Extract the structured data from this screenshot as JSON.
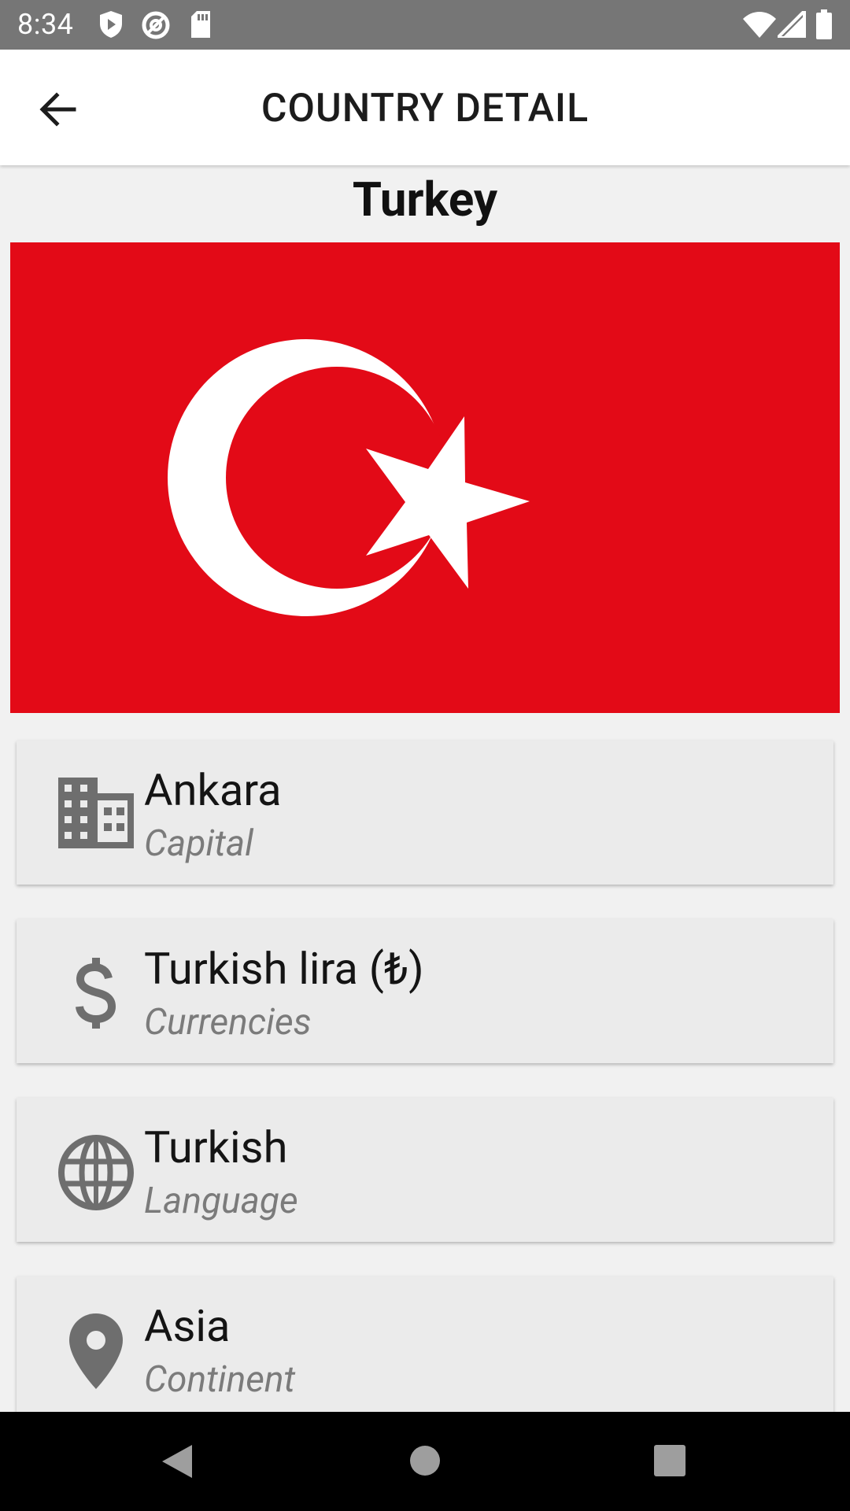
{
  "status_bar": {
    "time": "8:34",
    "left_icons": [
      "shield-icon",
      "at-sign-icon",
      "sd-card-icon"
    ],
    "right_icons": [
      "wifi-icon",
      "signal-icon",
      "battery-icon"
    ]
  },
  "app_bar": {
    "title": "COUNTRY DETAIL",
    "back_icon": "arrow-left-icon"
  },
  "country": {
    "name": "Turkey",
    "flag": {
      "background": "#e30a17",
      "emblem": "#ffffff"
    }
  },
  "details": [
    {
      "value": "Ankara",
      "label": "Capital",
      "icon": "building-icon"
    },
    {
      "value": "Turkish lira (₺)",
      "label": "Currencies",
      "icon": "dollar-icon"
    },
    {
      "value": "Turkish",
      "label": "Language",
      "icon": "globe-icon"
    },
    {
      "value": "Asia",
      "label": "Continent",
      "icon": "location-pin-icon"
    }
  ],
  "nav_bar": {
    "icons": [
      "back-triangle-icon",
      "home-circle-icon",
      "recents-square-icon"
    ]
  },
  "colors": {
    "status_bar": "#767676",
    "card_background": "#ebebeb",
    "icon_gray": "#6e6e6e"
  }
}
